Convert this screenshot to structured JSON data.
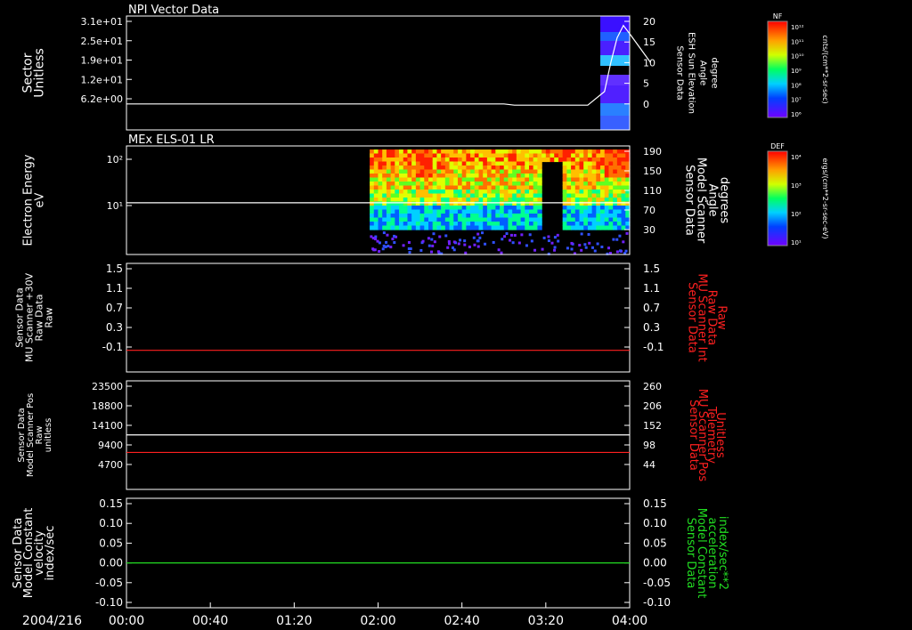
{
  "colors": {
    "white": "#ffffff",
    "red": "#ff2020",
    "green": "#22dd22",
    "background": "#000000"
  },
  "chart_data": [
    {
      "type": "line",
      "title": "NPI Vector Data",
      "ylabel_left": [
        "Sector",
        "Unitless"
      ],
      "ylabel_right": [
        "Sensor Data",
        "ESH Sun Elevation",
        "Angle",
        "degree"
      ],
      "left_ticks": [
        "3.1e+01",
        "2.5e+01",
        "1.9e+01",
        "1.2e+01",
        "6.2e+00"
      ],
      "right_ticks": [
        "20",
        "15",
        "10",
        "5",
        "0"
      ],
      "right_ylim": [
        -5,
        20
      ],
      "series": [
        {
          "color": "white",
          "axis": "right",
          "x": [
            0,
            180,
            185,
            220,
            228,
            231,
            234,
            237,
            240,
            250
          ],
          "y": [
            0,
            0,
            -0.3,
            -0.3,
            3,
            10,
            16,
            19,
            17,
            10
          ]
        }
      ],
      "spectrogram": {
        "x_start": 226,
        "x_end": 240
      },
      "colorbar": {
        "label": "NF",
        "unit": "cnts/(cm**2-sr-sec)",
        "tick_labels": [
          "10¹²",
          "10¹¹",
          "10¹⁰",
          "10⁹",
          "10⁸",
          "10⁷",
          "10⁶"
        ]
      }
    },
    {
      "type": "heatmap",
      "title": "MEx ELS-01 LR",
      "ylabel_left": [
        "Electron Energy",
        "eV"
      ],
      "ylabel_right": [
        "Sensor Data",
        "Model Scanner",
        "Angle",
        "degrees"
      ],
      "left_ticks": [
        "10²",
        "10¹"
      ],
      "right_ticks": [
        "190",
        "150",
        "110",
        "70",
        "30"
      ],
      "right_ylim": [
        0,
        190
      ],
      "series": [
        {
          "color": "white",
          "axis": "right",
          "x": [
            0,
            240
          ],
          "y": [
            90,
            90
          ]
        }
      ],
      "spectrogram": {
        "x_start": 116,
        "x_end": 240
      },
      "colorbar": {
        "label": "DEF",
        "unit": "ergs/(cm**2-sr-sec-eV)",
        "tick_labels": [
          "10⁴",
          "10³",
          "10²",
          "10¹"
        ]
      }
    },
    {
      "type": "line",
      "ylabel_left": [
        "Sensor Data",
        "MU Scanner +30V",
        "Raw Data",
        "Raw"
      ],
      "ylabel_right": [
        "Sensor Data",
        "MU Scanner Int",
        "Raw Data",
        "Raw"
      ],
      "left_ticks": [
        "1.5",
        "1.1",
        "0.7",
        "0.3",
        "-0.1"
      ],
      "right_ticks": [
        "1.5",
        "1.1",
        "0.7",
        "0.3",
        "-0.1"
      ],
      "ylim": [
        -0.3,
        1.5
      ],
      "series": [
        {
          "color": "red",
          "axis": "right",
          "x": [
            0,
            240
          ],
          "y": [
            0,
            0
          ]
        }
      ]
    },
    {
      "type": "line",
      "ylabel_left": [
        "Sensor Data",
        "Model Scanner Pos",
        "Raw",
        "unitless"
      ],
      "ylabel_right": [
        "Sensor Data",
        "MU Scanner Pos",
        "Telemetry",
        "Unitless"
      ],
      "left_ticks": [
        "23500",
        "18800",
        "14100",
        "9400",
        "4700"
      ],
      "right_ticks": [
        "260",
        "206",
        "152",
        "98",
        "44"
      ],
      "ylim": [
        0,
        23500
      ],
      "right_ylim": [
        0,
        260
      ],
      "series": [
        {
          "color": "white",
          "axis": "left",
          "x": [
            0,
            240
          ],
          "y": [
            11800,
            11800
          ]
        },
        {
          "color": "red",
          "axis": "right",
          "x": [
            0,
            240
          ],
          "y": [
            84,
            84
          ]
        }
      ]
    },
    {
      "type": "line",
      "ylabel_left": [
        "Sensor Data",
        "Model Constant",
        "velocity",
        "index/sec"
      ],
      "ylabel_right": [
        "Sensor Data",
        "Model Constant",
        "acceleration",
        "index/sec**2"
      ],
      "left_ticks": [
        "0.15",
        "0.10",
        "0.05",
        "0.00",
        "-0.05",
        "-0.10"
      ],
      "right_ticks": [
        "0.15",
        "0.10",
        "0.05",
        "0.00",
        "-0.05",
        "-0.10"
      ],
      "ylim": [
        -0.1,
        0.15
      ],
      "series": [
        {
          "color": "green",
          "axis": "right",
          "x": [
            0,
            240
          ],
          "y": [
            0,
            0
          ]
        }
      ]
    }
  ],
  "x_axis": {
    "date_label": "2004/216",
    "tick_labels": [
      "00:00",
      "00:40",
      "01:20",
      "02:00",
      "02:40",
      "03:20",
      "04:00"
    ],
    "xlim": [
      0,
      240
    ]
  }
}
